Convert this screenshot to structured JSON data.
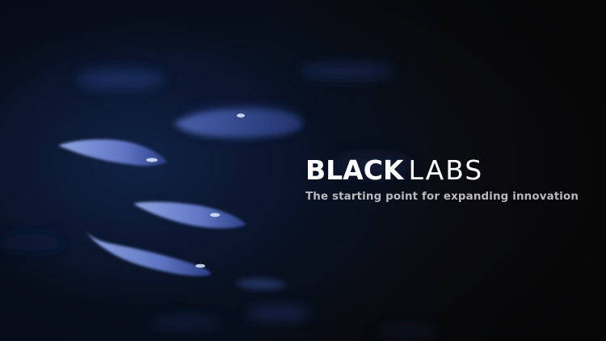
{
  "brand": {
    "name_bold": "BLACK",
    "name_light": "LABS"
  },
  "hero": {
    "tagline": "The starting point for expanding innovation",
    "background": "school-of-fish-in-dark-water",
    "accent_color": "#ffffff",
    "tagline_color": "#b9b9bb"
  }
}
